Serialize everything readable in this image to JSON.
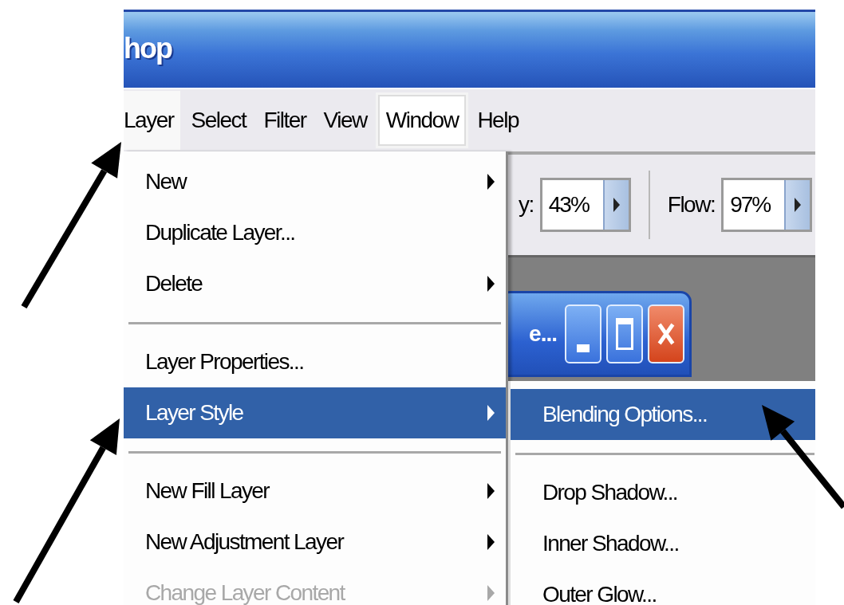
{
  "window": {
    "title": "hop"
  },
  "menu_bar": [
    {
      "label": "Layer",
      "selected": true,
      "hovered": false
    },
    {
      "label": "Select",
      "selected": false,
      "hovered": false
    },
    {
      "label": "Filter",
      "selected": false,
      "hovered": false
    },
    {
      "label": "View",
      "selected": false,
      "hovered": false
    },
    {
      "label": "Window",
      "selected": false,
      "hovered": true
    },
    {
      "label": "Help",
      "selected": false,
      "hovered": false
    }
  ],
  "options_bar": {
    "opacity_label": "y:",
    "opacity_value": "43%",
    "flow_label": "Flow:",
    "flow_value": "97%"
  },
  "document_window": {
    "title": "e..."
  },
  "layer_menu": [
    {
      "kind": "item",
      "label": "New",
      "submenu": true,
      "selected": false,
      "disabled": false
    },
    {
      "kind": "item",
      "label": "Duplicate Layer...",
      "submenu": false,
      "selected": false,
      "disabled": false
    },
    {
      "kind": "item",
      "label": "Delete",
      "submenu": true,
      "selected": false,
      "disabled": false
    },
    {
      "kind": "separator"
    },
    {
      "kind": "item",
      "label": "Layer Properties...",
      "submenu": false,
      "selected": false,
      "disabled": false
    },
    {
      "kind": "item",
      "label": "Layer Style",
      "submenu": true,
      "selected": true,
      "disabled": false
    },
    {
      "kind": "separator"
    },
    {
      "kind": "item",
      "label": "New Fill Layer",
      "submenu": true,
      "selected": false,
      "disabled": false
    },
    {
      "kind": "item",
      "label": "New Adjustment Layer",
      "submenu": true,
      "selected": false,
      "disabled": false
    },
    {
      "kind": "item",
      "label": "Change Layer Content",
      "submenu": true,
      "selected": false,
      "disabled": true
    }
  ],
  "layer_style_submenu": [
    {
      "kind": "item",
      "label": "Blending Options...",
      "selected": true
    },
    {
      "kind": "separator"
    },
    {
      "kind": "item",
      "label": "Drop Shadow...",
      "selected": false
    },
    {
      "kind": "item",
      "label": "Inner Shadow...",
      "selected": false
    },
    {
      "kind": "item",
      "label": "Outer Glow...",
      "selected": false
    }
  ]
}
